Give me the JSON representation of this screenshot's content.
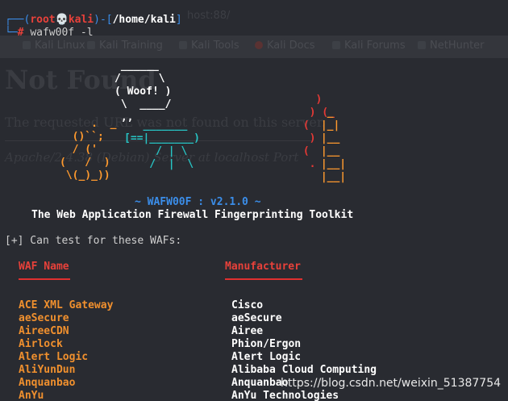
{
  "ghost": {
    "title": "host:88/",
    "tabs": [
      "Kali Linux",
      "Kali Training",
      "Kali Tools",
      "Kali Docs",
      "Kali Forums",
      "NetHunter"
    ],
    "heading": "Not Found",
    "message": "The requested URL was not found on this server.",
    "address": "Apache/2.4.38 (Debian) Server at localhost Port"
  },
  "prompt": {
    "open": "┌──(",
    "user": "root",
    "skull": "💀",
    "host": "kali",
    "mid": ")-[",
    "path": "/home/kali",
    "close": "]",
    "corner": "└─",
    "hash": "#",
    "command": "wafw00f -l"
  },
  "art": {
    "bubble": " ______\n/      \\\n( Woof! )\n \\  ____/\n ,,\n \\/",
    "dog": "   ___\n __/__.\\\n / ^ ^ \\ \n()`` ;\n ( (\n(   )\n \\(_)_))",
    "camera": "[==||=======\n   |_____|\n    / | \\\n   /  |  \\",
    "fire": "    )\n  ) (_\n (  |_|\n  ) |__\n (  |__\n  . |__",
    "dog_lines": [
      "  ,.  _ ",
      " ()``;  ",
      " ( (   ",
      "(   )  ",
      " \\(_)_))"
    ]
  },
  "banner": {
    "title": "~ WAFW00F : v2.1.0 ~",
    "tagline": "The Web Application Firewall Fingerprinting Toolkit"
  },
  "intro": "[+] Can test for these WAFs:",
  "columns": {
    "name": "WAF Name",
    "manufacturer": "Manufacturer"
  },
  "wafs": [
    {
      "name": "ACE XML Gateway",
      "manufacturer": "Cisco"
    },
    {
      "name": "aeSecure",
      "manufacturer": "aeSecure"
    },
    {
      "name": "AireeCDN",
      "manufacturer": "Airee"
    },
    {
      "name": "Airlock",
      "manufacturer": "Phion/Ergon"
    },
    {
      "name": "Alert Logic",
      "manufacturer": "Alert Logic"
    },
    {
      "name": "AliYunDun",
      "manufacturer": "Alibaba Cloud Computing"
    },
    {
      "name": "Anquanbao",
      "manufacturer": "Anquanbao"
    },
    {
      "name": "AnYu",
      "manufacturer": "AnYu Technologies"
    }
  ],
  "watermark": "https://blog.csdn.net/weixin_51387754",
  "colors": {
    "background": "#292b31",
    "prompt_blue": "#3b8eea",
    "prompt_red": "#e8413a",
    "waf_name_orange": "#f0902e",
    "banner_blue": "#3b8eea"
  }
}
